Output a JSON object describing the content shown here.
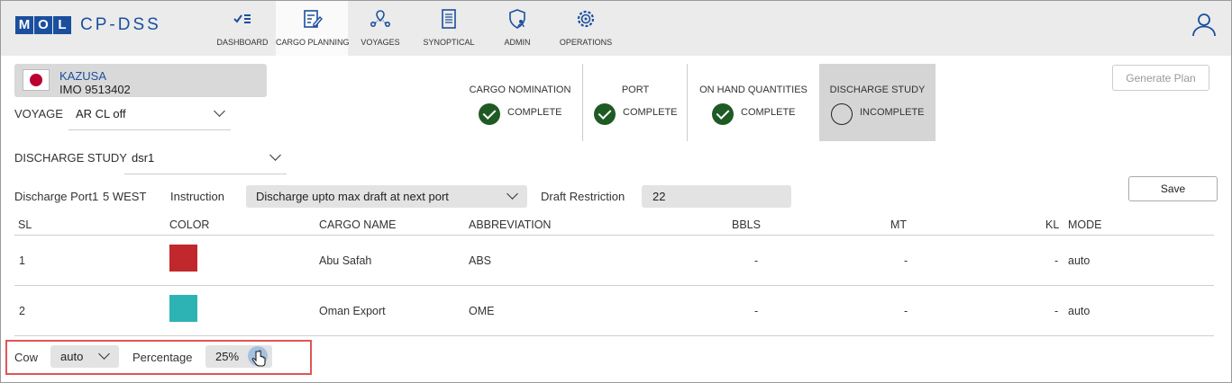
{
  "header": {
    "logo_letters": [
      "M",
      "O",
      "L"
    ],
    "app_name": "CP-DSS",
    "nav": [
      {
        "label": "DASHBOARD",
        "icon": "dashboard-check-list-icon"
      },
      {
        "label": "CARGO PLANNING",
        "icon": "cargo-planning-edit-icon"
      },
      {
        "label": "VOYAGES",
        "icon": "voyages-route-icon"
      },
      {
        "label": "SYNOPTICAL",
        "icon": "synoptical-document-icon"
      },
      {
        "label": "ADMIN",
        "icon": "admin-shield-user-icon"
      },
      {
        "label": "OPERATIONS",
        "icon": "operations-gear-icon"
      }
    ],
    "user_icon": "user-icon"
  },
  "vessel": {
    "name": "KAZUSA",
    "imo": "IMO 9513402",
    "flag": "japan-flag"
  },
  "voyage": {
    "label": "VOYAGE",
    "value": "AR CL off"
  },
  "steps": [
    {
      "title": "CARGO NOMINATION",
      "status": "COMPLETE",
      "done": true
    },
    {
      "title": "PORT",
      "status": "COMPLETE",
      "done": true
    },
    {
      "title": "ON HAND QUANTITIES",
      "status": "COMPLETE",
      "done": true
    },
    {
      "title": "DISCHARGE STUDY",
      "status": "INCOMPLETE",
      "done": false
    }
  ],
  "generate_plan": "Generate Plan",
  "discharge_study": {
    "label": "DISCHARGE STUDY",
    "value": "dsr1"
  },
  "port": {
    "label": "Discharge Port1",
    "name": "5 WEST",
    "instruction_label": "Instruction",
    "instruction_value": "Discharge upto max draft at next port",
    "draft_label": "Draft Restriction",
    "draft_value": "22"
  },
  "save": "Save",
  "table": {
    "headers": [
      "SL",
      "COLOR",
      "CARGO NAME",
      "ABBREVIATION",
      "BBLS",
      "MT",
      "KL",
      "MODE"
    ],
    "rows": [
      {
        "sl": "1",
        "color": "#c0282d",
        "name": "Abu Safah",
        "abbr": "ABS",
        "bbls": "-",
        "mt": "-",
        "kl": "-",
        "mode": "auto"
      },
      {
        "sl": "2",
        "color": "#2eb3b5",
        "name": "Oman Export",
        "abbr": "OME",
        "bbls": "-",
        "mt": "-",
        "kl": "-",
        "mode": "auto"
      }
    ]
  },
  "cow": {
    "label": "Cow",
    "value": "auto",
    "percentage_label": "Percentage",
    "percentage_value": "25%"
  },
  "colors": {
    "brand": "#1a4f9e",
    "complete": "#1f5a25",
    "highlight": "#e05555"
  }
}
